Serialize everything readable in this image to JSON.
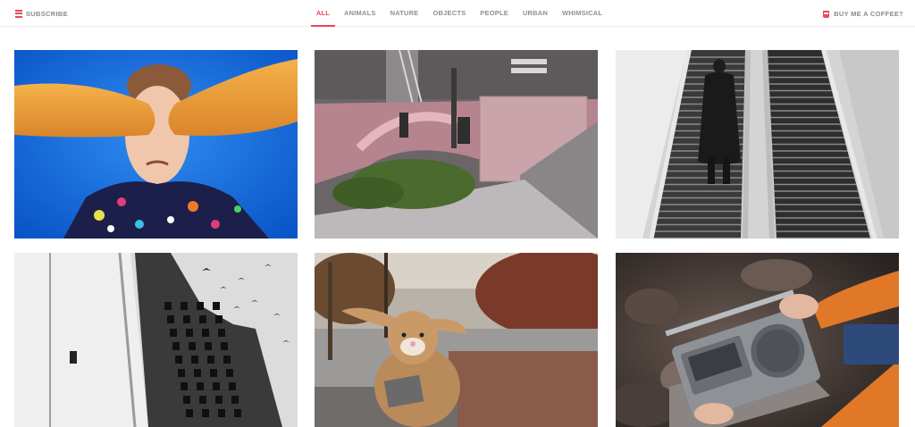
{
  "header": {
    "subscribe_label": "SUBSCRIBE",
    "coffee_label": "BUY ME A COFFEE?",
    "accent_color": "#e84858",
    "subscribe_icon": "menu-lines-icon",
    "coffee_icon": "coffee-cup-icon"
  },
  "nav": {
    "tabs": [
      {
        "label": "ALL",
        "active": true
      },
      {
        "label": "ANIMALS",
        "active": false
      },
      {
        "label": "NATURE",
        "active": false
      },
      {
        "label": "OBJECTS",
        "active": false
      },
      {
        "label": "PEOPLE",
        "active": false
      },
      {
        "label": "URBAN",
        "active": false
      },
      {
        "label": "WHIMSICAL",
        "active": false
      }
    ]
  }
}
